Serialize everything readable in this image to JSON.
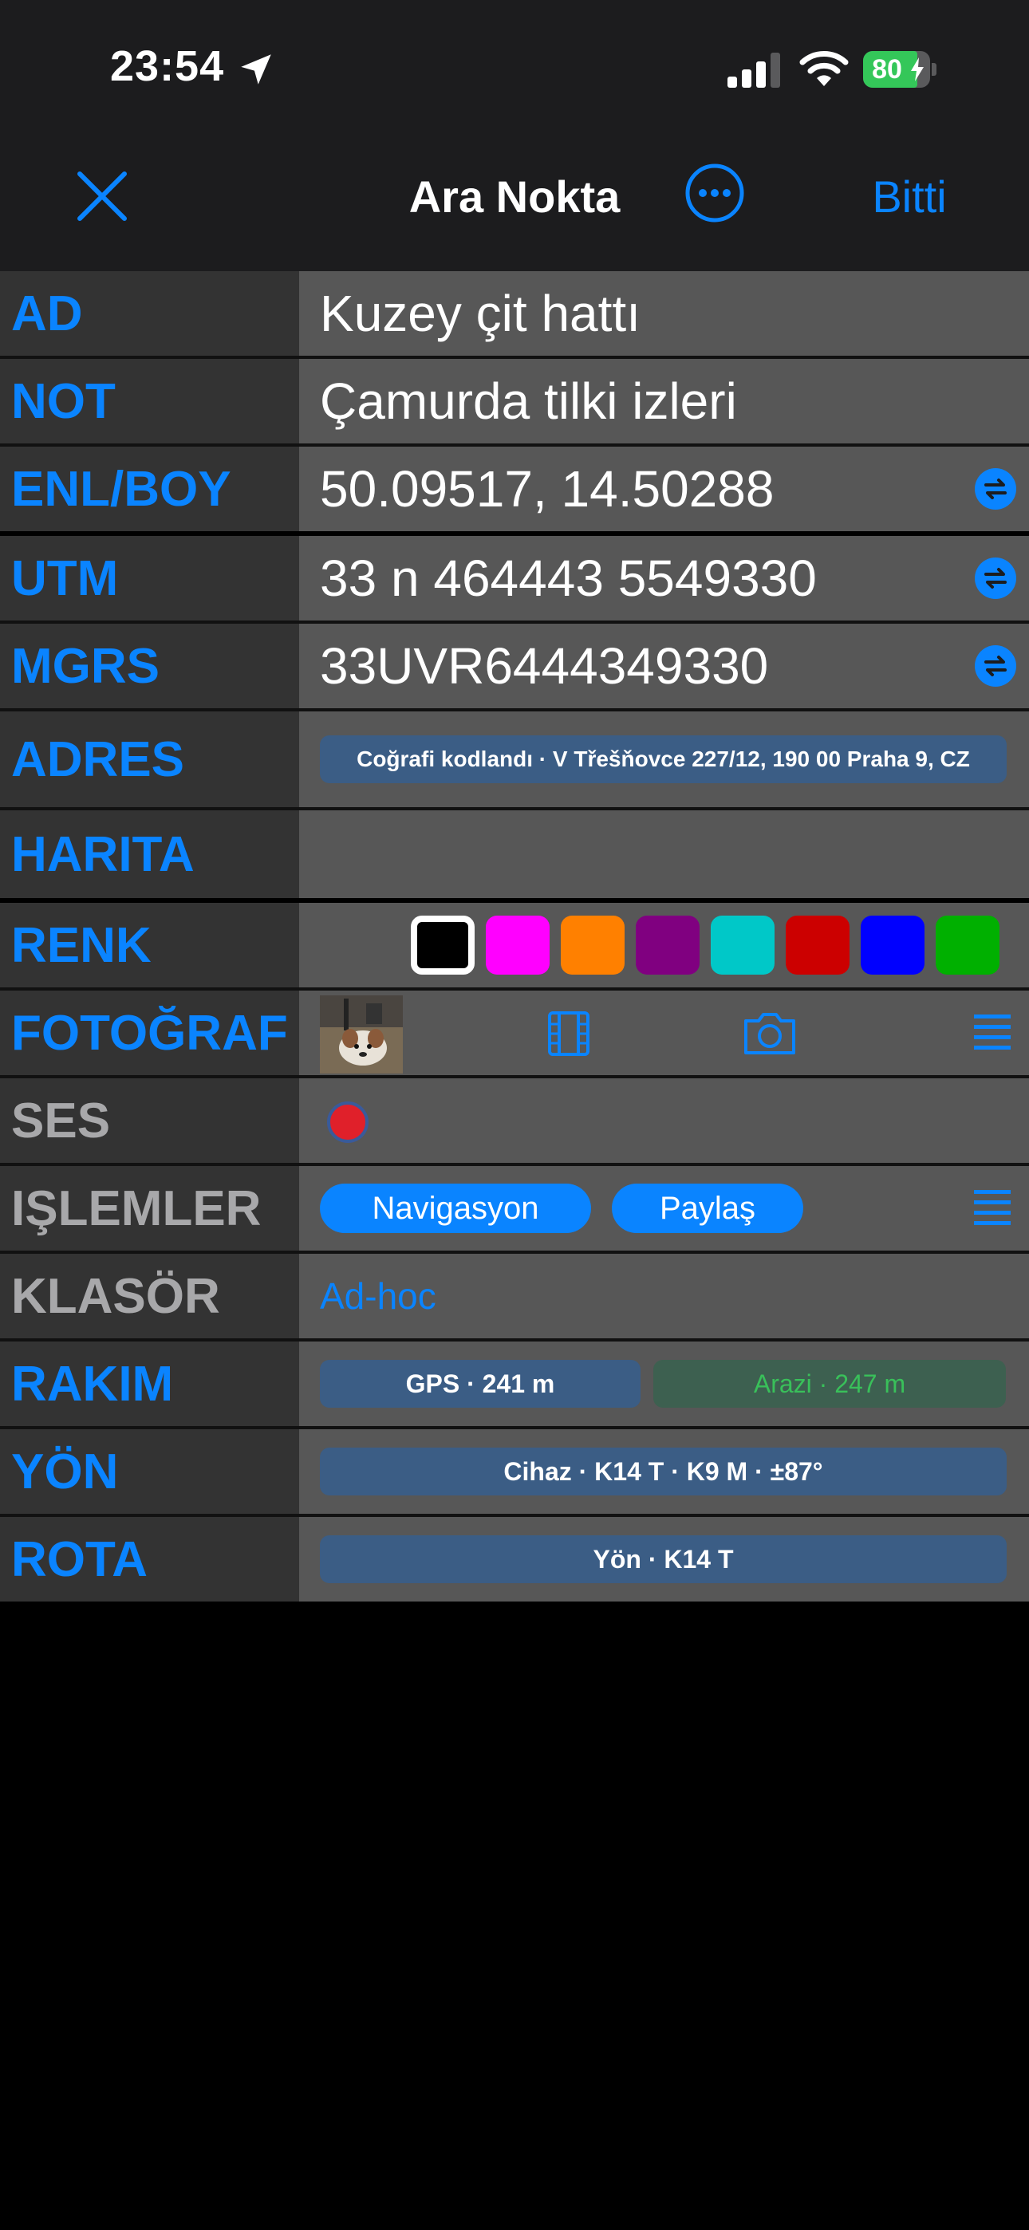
{
  "status_bar": {
    "time": "23:54",
    "battery": "80",
    "icons": [
      "location-arrow-icon",
      "cellular-signal-icon",
      "wifi-icon",
      "battery-charging-icon"
    ]
  },
  "nav": {
    "title": "Ara Nokta",
    "done_label": "Bitti",
    "icons": [
      "close-icon",
      "more-ellipsis-icon"
    ]
  },
  "rows": {
    "name": {
      "label": "AD",
      "value": "Kuzey çit hattı"
    },
    "note": {
      "label": "NOT",
      "value": "Çamurda tilki izleri"
    },
    "latlon": {
      "label": "ENL/BOY",
      "value": "50.09517, 14.50288"
    },
    "utm": {
      "label": "UTM",
      "value": "33 n 464443 5549330"
    },
    "mgrs": {
      "label": "MGRS",
      "value": "33UVR6444349330"
    },
    "address": {
      "label": "ADRES",
      "value": "Coğrafi kodlandı · V Třešňovce 227/12, 190 00 Praha 9, CZ"
    },
    "map": {
      "label": "HARITA"
    },
    "color": {
      "label": "RENK",
      "swatches": [
        "#000000",
        "#ff00ff",
        "#ff8000",
        "#800080",
        "#00c8c8",
        "#cc0000",
        "#0000ff",
        "#00b000"
      ],
      "selected": "#000000"
    },
    "photo": {
      "label": "FOTOĞRAF",
      "icons": [
        "photo-thumbnail",
        "film-icon",
        "camera-icon",
        "list-menu-icon"
      ]
    },
    "audio": {
      "label": "SES",
      "icons": [
        "record-button-icon"
      ]
    },
    "actions": {
      "label": "IŞLEMLER",
      "navigate": "Navigasyon",
      "share": "Paylaş"
    },
    "folder": {
      "label": "KLASÖR",
      "value": "Ad-hoc"
    },
    "altitude": {
      "label": "RAKIM",
      "gps": "GPS · 241 m",
      "terrain": "Arazi · 247 m"
    },
    "heading": {
      "label": "YÖN",
      "value": "Cihaz · K14 T · K9 M · ±87°"
    },
    "route": {
      "label": "ROTA",
      "value": "Yön · K14 T"
    }
  },
  "colors": {
    "accent": "#0a84ff",
    "label_bg": "#333333",
    "value_bg": "#575757",
    "chip_bg": "#3b5d85",
    "terrain_text": "#39c05a"
  }
}
